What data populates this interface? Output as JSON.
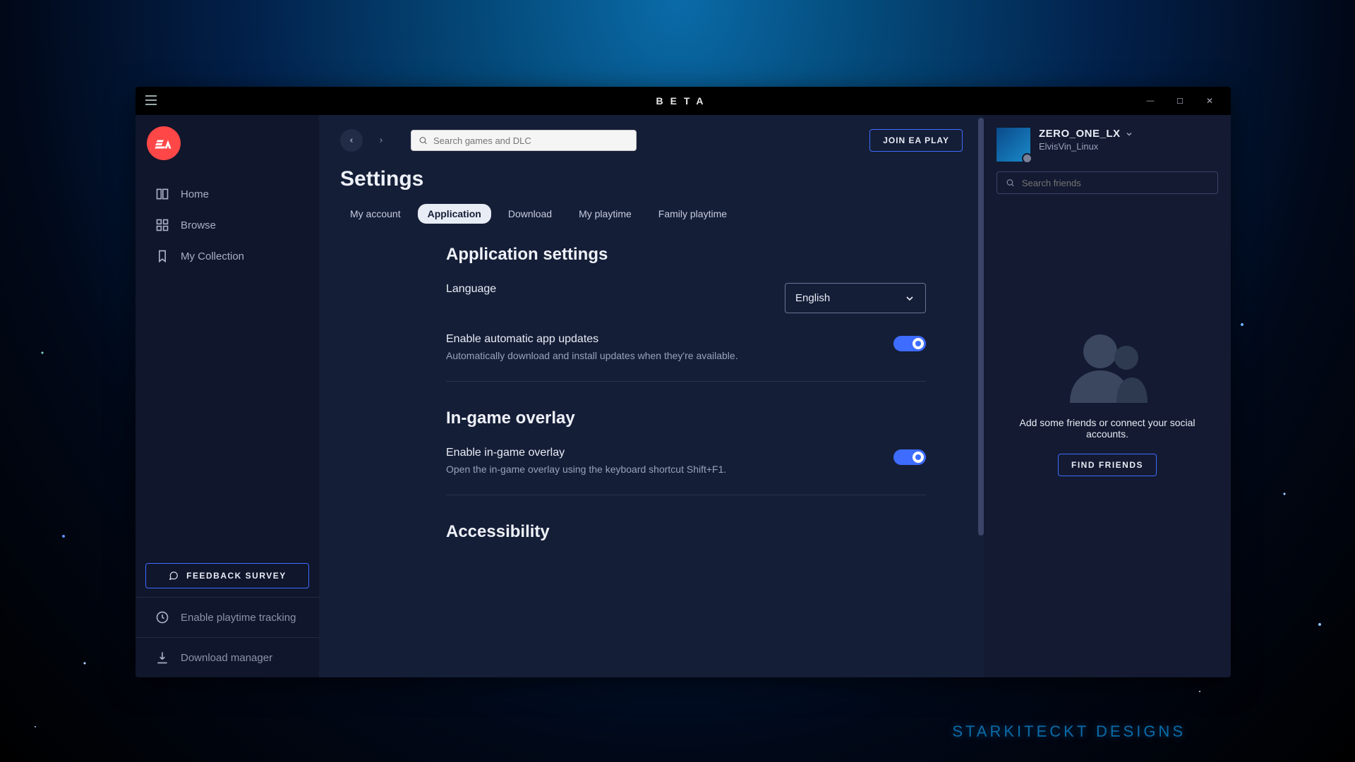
{
  "titlebar": {
    "label": "BETA"
  },
  "sidebar": {
    "nav": [
      {
        "label": "Home"
      },
      {
        "label": "Browse"
      },
      {
        "label": "My Collection"
      }
    ],
    "feedback_label": "FEEDBACK SURVEY",
    "playtime_label": "Enable playtime tracking",
    "download_manager_label": "Download manager"
  },
  "topbar": {
    "search_placeholder": "Search games and DLC",
    "join_label": "JOIN EA PLAY"
  },
  "page": {
    "title": "Settings",
    "tabs": [
      {
        "label": "My account"
      },
      {
        "label": "Application"
      },
      {
        "label": "Download"
      },
      {
        "label": "My playtime"
      },
      {
        "label": "Family playtime"
      }
    ],
    "sections": {
      "app": {
        "title": "Application settings",
        "language_label": "Language",
        "language_value": "English",
        "auto_update_label": "Enable automatic app updates",
        "auto_update_desc": "Automatically download and install updates when they're available."
      },
      "overlay": {
        "title": "In-game overlay",
        "enable_label": "Enable in-game overlay",
        "enable_desc": "Open the in-game overlay using the keyboard shortcut Shift+F1."
      },
      "accessibility": {
        "title": "Accessibility"
      }
    }
  },
  "friends": {
    "username": "ZERO_ONE_LX",
    "handle": "ElvisVin_Linux",
    "search_placeholder": "Search friends",
    "empty_text": "Add some friends or connect your social accounts.",
    "find_label": "FIND FRIENDS"
  },
  "watermark": "STARKITECKT DESIGNS"
}
